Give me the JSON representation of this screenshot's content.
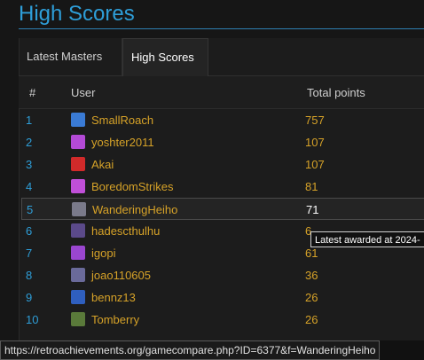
{
  "title": "High Scores",
  "tabs": [
    {
      "label": "Latest Masters",
      "active": false
    },
    {
      "label": "High Scores",
      "active": true
    }
  ],
  "columns": [
    "#",
    "User",
    "Total points"
  ],
  "rows": [
    {
      "rank": "1",
      "user": "SmallRoach",
      "points": "757",
      "avatar_color": "#3a7bd5"
    },
    {
      "rank": "2",
      "user": "yoshter2011",
      "points": "107",
      "avatar_color": "#b44ad6"
    },
    {
      "rank": "3",
      "user": "Akai",
      "points": "107",
      "avatar_color": "#d12a2a"
    },
    {
      "rank": "4",
      "user": "BoredomStrikes",
      "points": "81",
      "avatar_color": "#c04fd8"
    },
    {
      "rank": "5",
      "user": "WanderingHeiho",
      "points": "71",
      "avatar_color": "#7a7a8a"
    },
    {
      "rank": "6",
      "user": "hadescthulhu",
      "points": "6",
      "avatar_color": "#5b4a8a"
    },
    {
      "rank": "7",
      "user": "igopi",
      "points": "61",
      "avatar_color": "#9a46d0"
    },
    {
      "rank": "8",
      "user": "joao110605",
      "points": "36",
      "avatar_color": "#6a6a9a"
    },
    {
      "rank": "9",
      "user": "bennz13",
      "points": "26",
      "avatar_color": "#2f5fbf"
    },
    {
      "rank": "10",
      "user": "Tomberry",
      "points": "26",
      "avatar_color": "#5a7a3a"
    }
  ],
  "tooltip": "Latest awarded at 2024-",
  "status_url": "https://retroachievements.org/gamecompare.php?ID=6377&f=WanderingHeiho",
  "colors": {
    "accent": "#2e9ed8",
    "gold": "#d6a228"
  }
}
